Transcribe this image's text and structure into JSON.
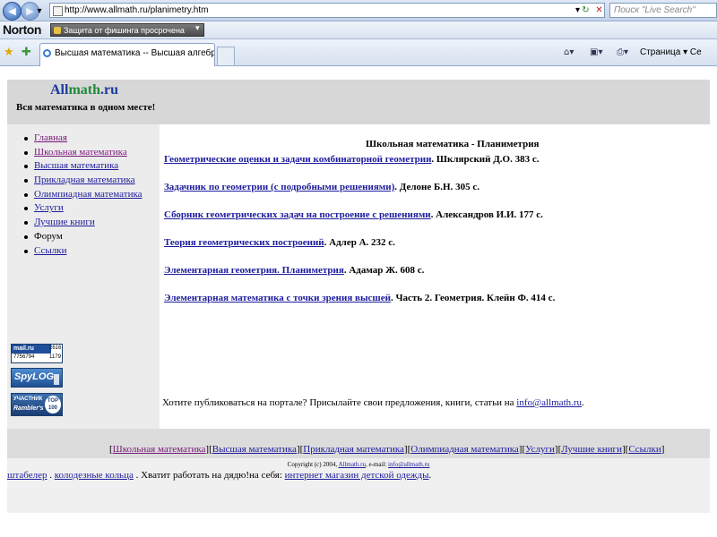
{
  "browser": {
    "url": "http://www.allmath.ru/planimetry.htm",
    "search_placeholder": "Поиск \"Live Search\"",
    "norton_label": "Norton",
    "norton_status": "Защита от фишинга просрочена",
    "tab_title": "Высшая математика -- Высшая алгебра, дискр...",
    "tool_page": "Страница",
    "tool_more": "Се"
  },
  "site": {
    "logo_all": "All",
    "logo_math": "math",
    "logo_ru": ".ru",
    "tagline": "Вся математика в одном месте!",
    "nav": [
      {
        "label": "Главная",
        "link": true,
        "visited": true
      },
      {
        "label": "Школьная математика",
        "link": true,
        "visited": true
      },
      {
        "label": "Высшая математика",
        "link": true,
        "visited": false
      },
      {
        "label": "Прикладная математика",
        "link": true,
        "visited": false
      },
      {
        "label": "Олимпиадная математика",
        "link": true,
        "visited": false
      },
      {
        "label": "Услуги",
        "link": true,
        "visited": false
      },
      {
        "label": "Лучшие книги",
        "link": true,
        "visited": false
      },
      {
        "label": "Форум",
        "link": false,
        "visited": false
      },
      {
        "label": "Ссылки",
        "link": true,
        "visited": false
      }
    ],
    "counters": {
      "mailru": {
        "brand": "mail.ru",
        "num1": "7756794",
        "num2": "2616",
        "num3": "1179"
      },
      "spylog": {
        "brand": "SpyLOG"
      },
      "rambler": {
        "line1": "УЧАСТНИК",
        "line2": "Rambler's",
        "badge1": "TOP",
        "badge2": "100"
      }
    },
    "content_title": "Школьная математика - Планиметрия",
    "books": [
      {
        "title": "Геометрические оценки и задачи комбинаторной геометрии",
        "info": ". Шклярский Д.О. 383 с."
      },
      {
        "title": "Задачник по геометрии (с подробными решениями)",
        "info": ". Делоне Б.Н. 305 с."
      },
      {
        "title": "Сборник геометрических задач на построение с решениями",
        "info": ". Александров И.И. 177 с."
      },
      {
        "title": "Теория геометрических построений",
        "info": ". Адлер А. 232 с."
      },
      {
        "title": "Элементарная геометрия. Планиметрия",
        "info": ". Адамар Ж. 608 с."
      },
      {
        "title": "Элементарная математика с точки зрения высшей",
        "info": ". Часть 2. Геометрия. Клейн Ф. 414 с."
      }
    ],
    "publish_text": "Хотите публиковаться на портале? Присылайте свои предложения, книги, статьи на ",
    "publish_email": "info@allmath.ru",
    "publish_end": ".",
    "footer_links": [
      "Школьная математика",
      "Высшая математика",
      "Прикладная математика",
      "Олимпиадная математика",
      "Услуги",
      "Лучшие книги",
      "Ссылки"
    ],
    "copyright_text": "Copyright (c) 2004, ",
    "copyright_site": "Allmath.ru",
    "copyright_email_label": ", e-mail: ",
    "copyright_email": "info@allmath.ru"
  },
  "ads": {
    "link1": "штабелер",
    "sep1": " . ",
    "link2": "колодезные кольца",
    "text": " . Хватит работать на дядю!на себя: ",
    "link3": "интернет магазин детской одежды",
    "end": "."
  },
  "colors": {
    "link": "#1c1c9c",
    "visited": "#7a1a7a",
    "header_bg": "#d7d7d7"
  }
}
